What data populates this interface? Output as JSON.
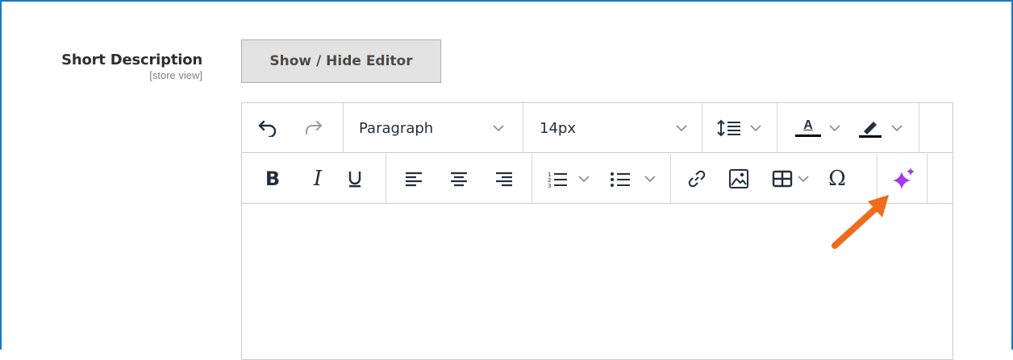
{
  "field": {
    "label": "Short Description",
    "scope": "[store view]"
  },
  "toggle_button": {
    "label": "Show / Hide Editor"
  },
  "toolbar": {
    "block_format": "Paragraph",
    "font_size": "14px",
    "text_color_letter": "A",
    "bold": "B",
    "italic": "I",
    "special_char": "Ω"
  },
  "colors": {
    "frame": "#1979c3",
    "ai_sparkle": "#a638f0",
    "arrow": "#f26a1b"
  }
}
